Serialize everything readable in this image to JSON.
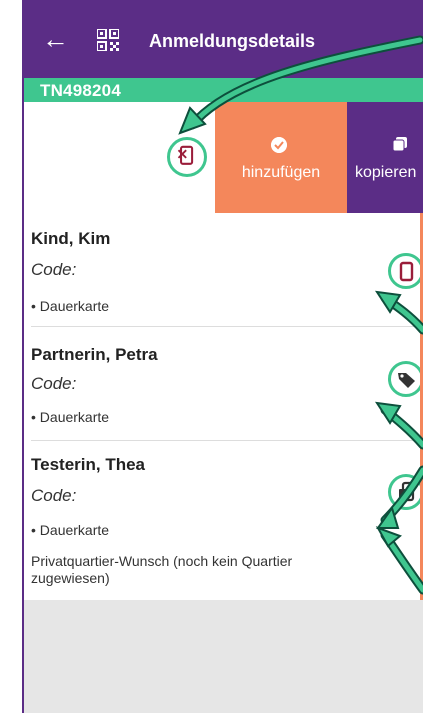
{
  "header": {
    "title": "Anmeldungsdetails"
  },
  "id_bar": {
    "registration_id": "TN498204"
  },
  "swipe_actions": {
    "add_label": "hinzufügen",
    "copy_label": "kopieren"
  },
  "participants": [
    {
      "name": "Kind, Kim",
      "code_label": "Code:",
      "ticket": "Dauerkarte",
      "status_icon": "phone-icon"
    },
    {
      "name": "Partnerin, Petra",
      "code_label": "Code:",
      "ticket": "Dauerkarte",
      "status_icon": "tag-icon"
    },
    {
      "name": "Testerin, Thea",
      "code_label": "Code:",
      "ticket": "Dauerkarte",
      "status_icon": "phone-send-icon",
      "note": "Privatquartier-Wunsch (noch kein Quartier zugewiesen)"
    }
  ],
  "colors": {
    "primary": "#5b2d86",
    "accent": "#3fc68f",
    "action_orange": "#f4875b",
    "icon_red": "#9a1d3a"
  }
}
